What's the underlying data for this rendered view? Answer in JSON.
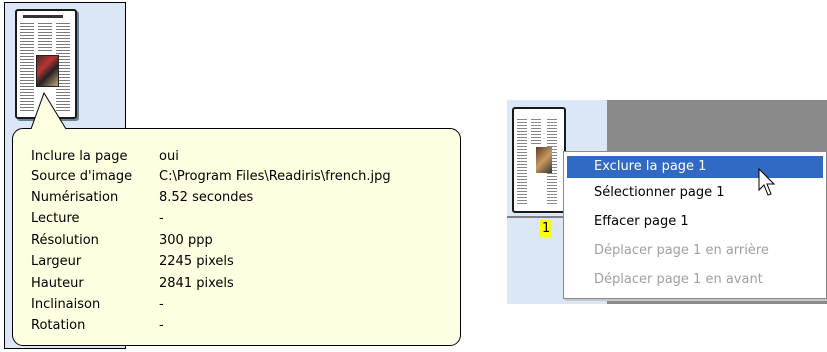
{
  "tooltip": {
    "rows": [
      {
        "label": "Inclure la page",
        "value": "oui"
      },
      {
        "label": "Source d'image",
        "value": "C:\\Program Files\\Readiris\\french.jpg"
      },
      {
        "label": "Numérisation",
        "value": "8.52 secondes"
      },
      {
        "label": "Lecture",
        "value": "-"
      },
      {
        "label": "Résolution",
        "value": "300 ppp"
      },
      {
        "label": "Largeur",
        "value": "2245 pixels"
      },
      {
        "label": "Hauteur",
        "value": "2841 pixels"
      },
      {
        "label": "Inclinaison",
        "value": "-"
      },
      {
        "label": "Rotation",
        "value": "-"
      }
    ]
  },
  "right_panel": {
    "page_number": "1",
    "page_number_highlight": "#ffff00"
  },
  "context_menu": {
    "items": [
      {
        "label": "Exclure la page 1",
        "state": "highlighted"
      },
      {
        "label": "Sélectionner page 1",
        "state": "enabled"
      },
      {
        "label": "Effacer page 1",
        "state": "enabled"
      },
      {
        "label": "Déplacer page 1 en arrière",
        "state": "disabled"
      },
      {
        "label": "Déplacer page 1 en avant",
        "state": "disabled"
      }
    ],
    "highlight_color": "#316ac5"
  },
  "colors": {
    "panel_background": "#dbe6f7",
    "tooltip_background": "#ffffe1",
    "disabled_text": "#a0a0a0"
  }
}
